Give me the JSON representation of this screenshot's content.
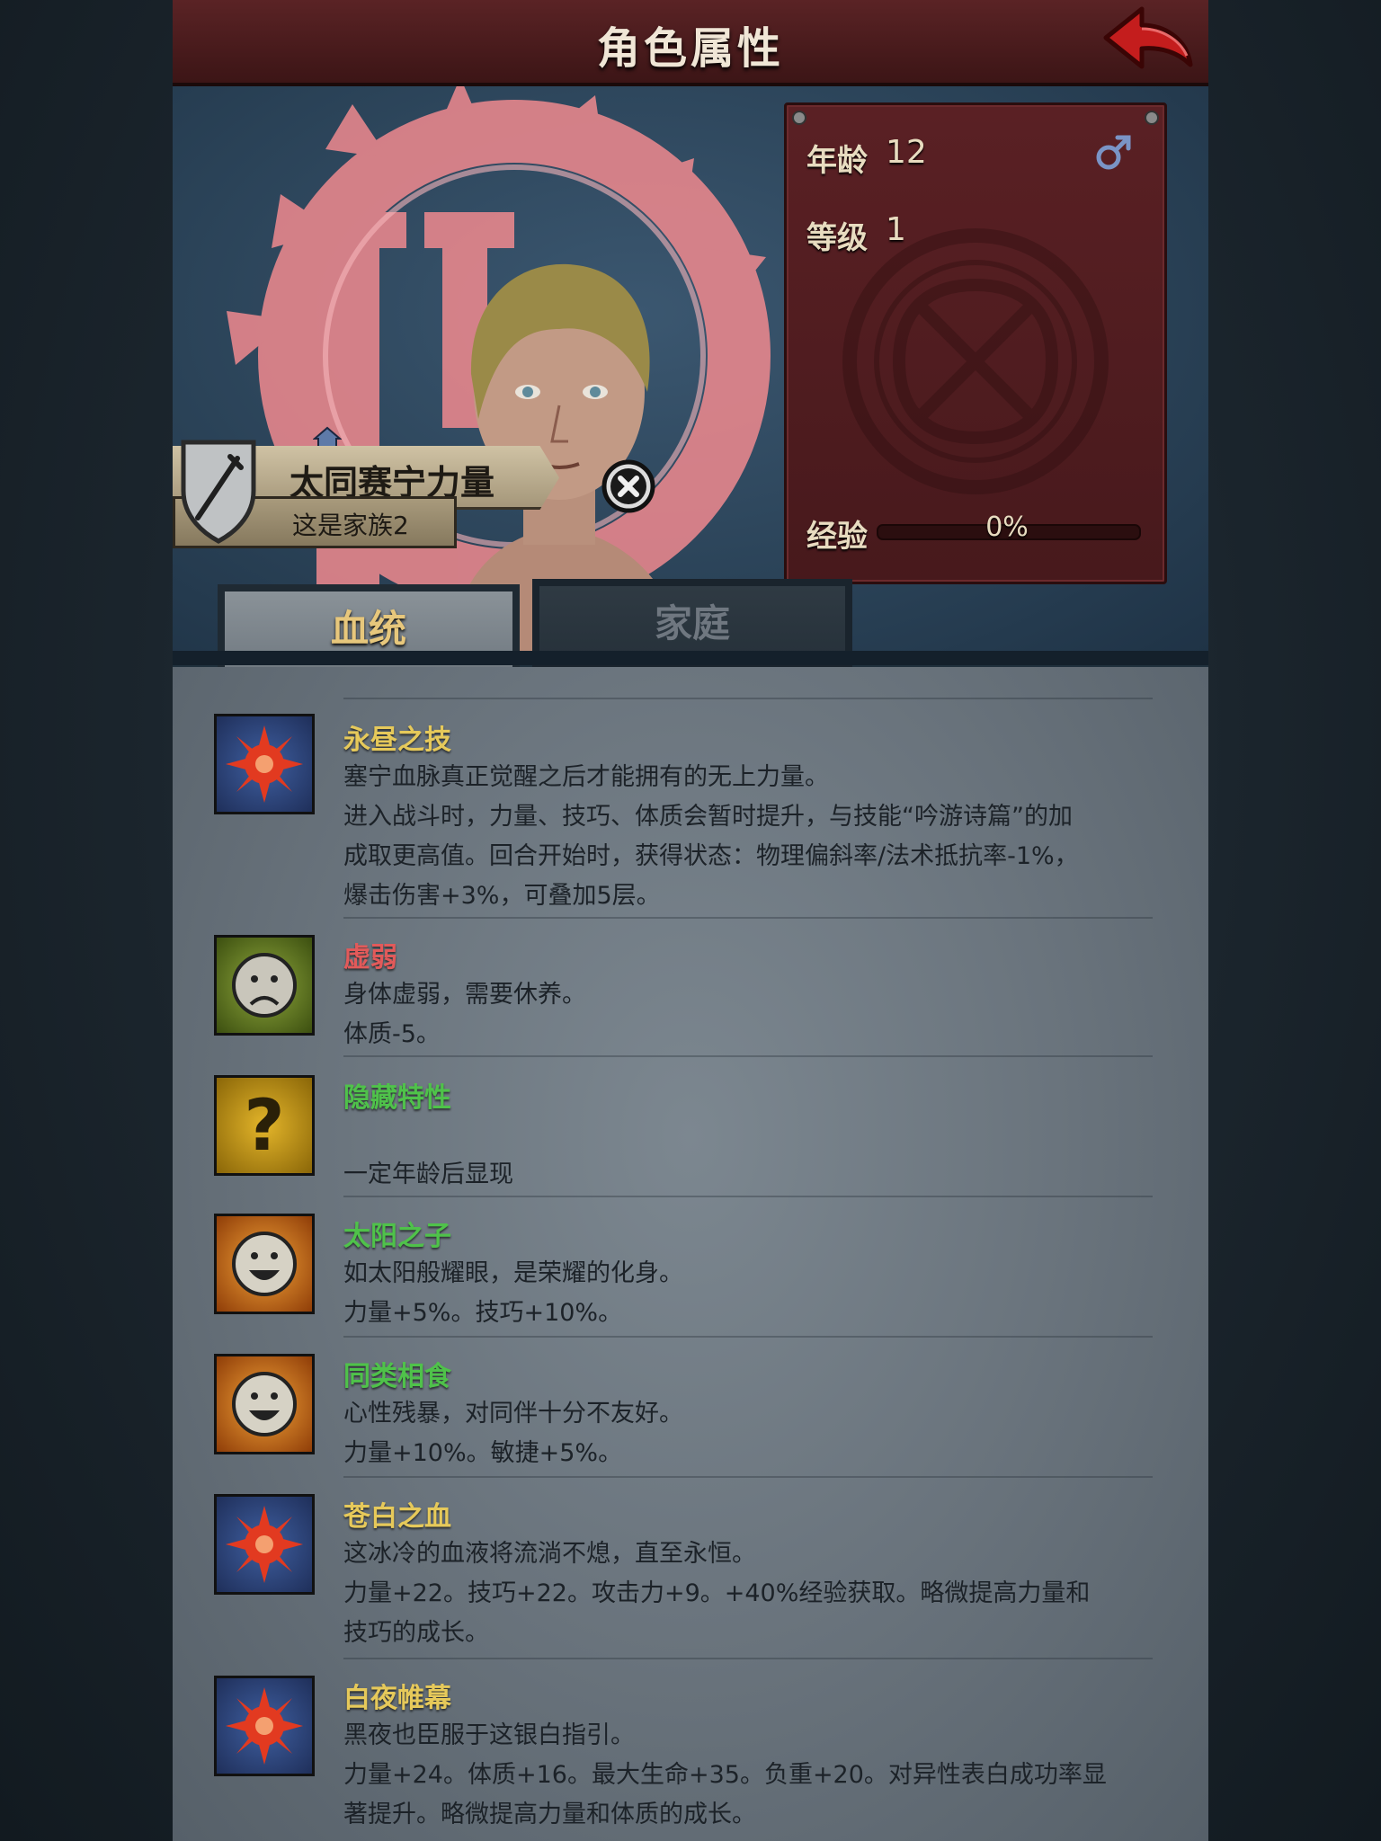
{
  "header": {
    "title": "角色属性"
  },
  "stats": {
    "age_label": "年龄",
    "age_value": "12",
    "level_label": "等级",
    "level_value": "1",
    "exp_label": "经验",
    "exp_percent_text": "0%",
    "exp_progress": 0,
    "gender_icon": "male-symbol-icon"
  },
  "character": {
    "name": "太同赛宁力量",
    "family": "这是家族2"
  },
  "tabs": [
    {
      "label": "血统",
      "active": true
    },
    {
      "label": "家庭",
      "active": false
    }
  ],
  "traits": [
    {
      "title": "永昼之技",
      "title_color": "#e6c95a",
      "icon": "sun-rune-icon",
      "lines": [
        "塞宁血脉真正觉醒之后才能拥有的无上力量。",
        "进入战斗时，力量、技巧、体质会暂时提升，与技能“吟游诗篇”的加",
        "成取更高值。回合开始时，获得状态：物理偏斜率/法术抵抗率-1%，",
        "爆击伤害+3%，可叠加5层。"
      ]
    },
    {
      "title": "虚弱",
      "title_color": "#e25a5a",
      "icon": "sad-face-icon",
      "lines": [
        "身体虚弱，需要休养。",
        "体质-5。"
      ]
    },
    {
      "title": "隐藏特性",
      "title_color": "#4fc24a",
      "icon": "question-mark-icon",
      "lines": [
        "",
        "一定年龄后显现"
      ]
    },
    {
      "title": "太阳之子",
      "title_color": "#4fc24a",
      "icon": "happy-sun-face-icon",
      "lines": [
        "如太阳般耀眼，是荣耀的化身。",
        "力量+5%。技巧+10%。"
      ]
    },
    {
      "title": "同类相食",
      "title_color": "#4fc24a",
      "icon": "happy-sun-face-icon",
      "lines": [
        "心性残暴，对同伴十分不友好。",
        "力量+10%。敏捷+5%。"
      ]
    },
    {
      "title": "苍白之血",
      "title_color": "#e6c95a",
      "icon": "sun-rune-icon",
      "lines": [
        "这冰冷的血液将流淌不熄，直至永恒。",
        "力量+22。技巧+22。攻击力+9。+40%经验获取。略微提高力量和",
        "技巧的成长。"
      ]
    },
    {
      "title": "白夜帷幕",
      "title_color": "#e6c95a",
      "icon": "sun-rune-icon",
      "lines": [
        "黑夜也臣服于这银白指引。",
        "力量+24。体质+16。最大生命+35。负重+20。对异性表白成功率显",
        "著提升。略微提高力量和体质的成长。"
      ]
    }
  ]
}
